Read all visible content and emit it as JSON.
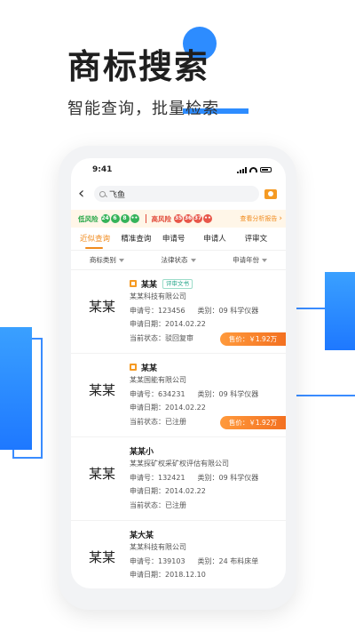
{
  "hero": {
    "title": "商标搜索",
    "subtitle": "智能查询，批量检索"
  },
  "status_bar": {
    "time": "9:41"
  },
  "search": {
    "query": "飞鱼"
  },
  "risk": {
    "low_label": "低风险",
    "low_counts": [
      "24",
      "6",
      "8",
      "••"
    ],
    "high_label": "高风险",
    "high_counts": [
      "35",
      "36",
      "37",
      "••"
    ],
    "view_link": "查看分析报告"
  },
  "tabs": [
    "近似查询",
    "精准查询",
    "申请号",
    "申请人",
    "评审文"
  ],
  "filters": [
    "商标类别",
    "法律状态",
    "申请年份"
  ],
  "labels": {
    "app_no": "申请号：",
    "category": "类别：",
    "app_date": "申请日期：",
    "status": "当前状态："
  },
  "results": [
    {
      "thumb": "某某",
      "name": "某某",
      "badge": "评审文书",
      "company": "某某科技有限公司",
      "app_no": "123456",
      "category": "09 科学仪器",
      "app_date": "2014.02.22",
      "status": "驳回复审",
      "price": "售价：￥1.92万"
    },
    {
      "thumb": "某某",
      "name": "某某",
      "company": "某某国能有限公司",
      "app_no": "634231",
      "category": "09 科学仪器",
      "app_date": "2014.02.22",
      "status": "已注册",
      "price": "售价：￥1.92万"
    },
    {
      "thumb": "某某",
      "name": "某某小",
      "company": "某某探矿权采矿权评估有限公司",
      "app_no": "132421",
      "category": "09 科学仪器",
      "app_date": "2014.02.22",
      "status": "已注册"
    },
    {
      "thumb": "某某",
      "name": "某大某",
      "company": "某某科技有限公司",
      "app_no": "139103",
      "category": "24 布料床单",
      "app_date": "2018.12.10"
    }
  ]
}
